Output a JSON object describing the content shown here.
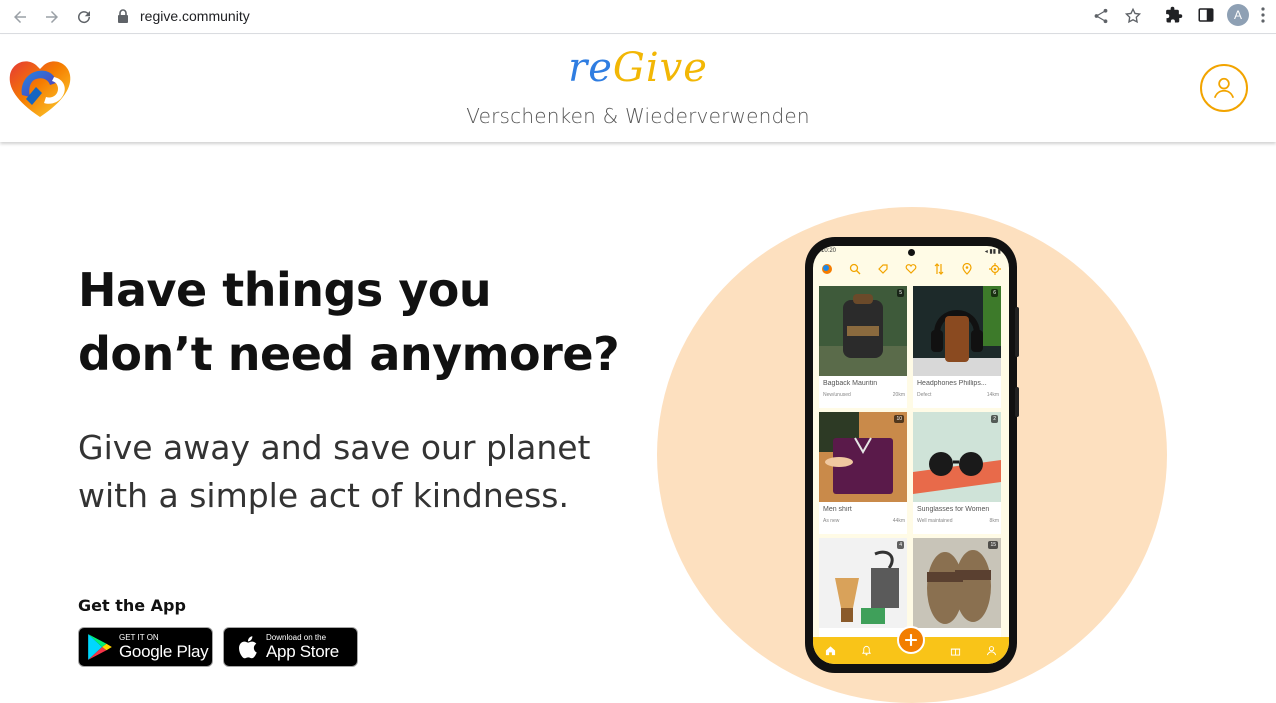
{
  "browser": {
    "url": "regive.community",
    "avatar_letter": "A"
  },
  "header": {
    "brand_re": "re",
    "brand_give": "Give",
    "tagline": "Verschenken & Wiederverwenden"
  },
  "hero": {
    "title": "Have things you don’t need anymore?",
    "subtitle": "Give away and save our planet with a simple act of kindness.",
    "get_app": "Get the App",
    "google_play_small": "GET IT ON",
    "google_play_big": "Google Play",
    "app_store_small": "Download on the",
    "app_store_big": "App Store"
  },
  "phone": {
    "time": "10:20",
    "items": [
      {
        "name": "Bagback Mauritin",
        "condition": "New/unused",
        "distance": "20km",
        "badge": "5"
      },
      {
        "name": "Headphones Phillips...",
        "condition": "Defect",
        "distance": "14km",
        "badge": "6"
      },
      {
        "name": "Men shirt",
        "condition": "As new",
        "distance": "44km",
        "badge": "10"
      },
      {
        "name": "Sunglasses for Women",
        "condition": "Well maintained",
        "distance": "8km",
        "badge": "2"
      },
      {
        "name": "",
        "condition": "",
        "distance": "",
        "badge": "4"
      },
      {
        "name": "",
        "condition": "",
        "distance": "",
        "badge": "15"
      }
    ]
  },
  "colors": {
    "accent_blue": "#2f7de1",
    "accent_yellow": "#f2b705",
    "circle_bg": "#fde0bf",
    "fab_orange": "#f27e00"
  }
}
